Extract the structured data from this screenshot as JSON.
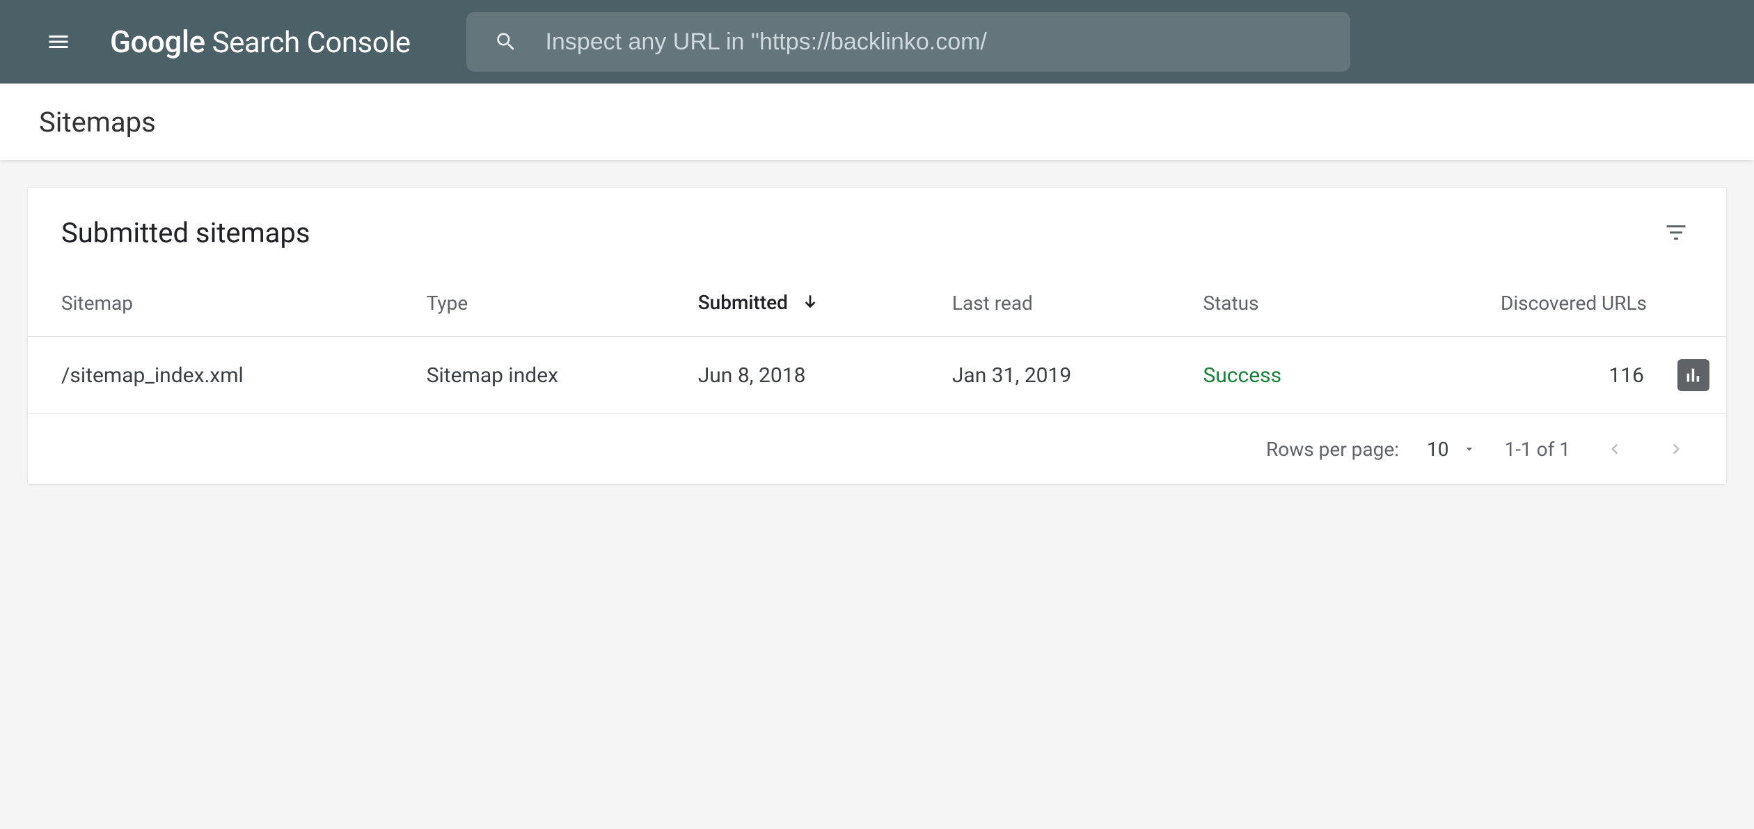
{
  "header": {
    "logo_google": "Google",
    "logo_rest": "Search Console",
    "search_placeholder": "Inspect any URL in \"https://backlinko.com/"
  },
  "page_title": "Sitemaps",
  "card": {
    "title": "Submitted sitemaps",
    "columns": {
      "sitemap": "Sitemap",
      "type": "Type",
      "submitted": "Submitted",
      "last_read": "Last read",
      "status": "Status",
      "discovered": "Discovered URLs"
    },
    "sorted_column": "submitted",
    "sort_direction": "desc",
    "rows": [
      {
        "sitemap": "/sitemap_index.xml",
        "type": "Sitemap index",
        "submitted": "Jun 8, 2018",
        "last_read": "Jan 31, 2019",
        "status": "Success",
        "discovered": "116"
      }
    ]
  },
  "pagination": {
    "rows_label": "Rows per page:",
    "rows_value": "10",
    "range": "1-1 of 1"
  }
}
